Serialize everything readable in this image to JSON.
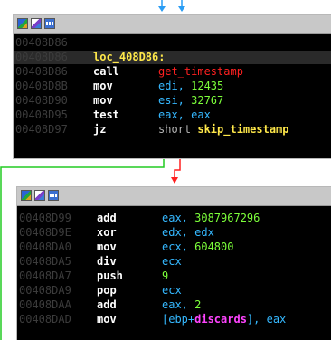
{
  "colors": {
    "node_bg": "#000000",
    "address": "#3c3c3c",
    "mnemonic": "#ffffff",
    "label": "#ffe84a",
    "call_target": "#ff2020",
    "register": "#35b8ff",
    "immediate": "#7cff3a",
    "var": "#ff44ff",
    "edge_true": "#22cc22",
    "edge_false": "#ff2020",
    "edge_blue": "#2a9df4"
  },
  "toolbar_icons": [
    "graph-colored-icon",
    "edit-color-icon",
    "assembly-view-icon"
  ],
  "block1": {
    "lines": [
      {
        "addr": "00408D86",
        "mn": "",
        "ops": []
      },
      {
        "addr": "00408D86",
        "label": "loc_408D86:"
      },
      {
        "addr": "00408D86",
        "mn": "call",
        "ops": [
          {
            "text": "get_timestamp",
            "cls": "op-red"
          }
        ]
      },
      {
        "addr": "00408D8B",
        "mn": "mov",
        "ops": [
          {
            "text": "edi, ",
            "cls": "op-cyan"
          },
          {
            "text": "12435",
            "cls": "op-lime"
          }
        ]
      },
      {
        "addr": "00408D90",
        "mn": "mov",
        "ops": [
          {
            "text": "esi, ",
            "cls": "op-cyan"
          },
          {
            "text": "32767",
            "cls": "op-lime"
          }
        ]
      },
      {
        "addr": "00408D95",
        "mn": "test",
        "ops": [
          {
            "text": "eax, eax",
            "cls": "op-cyan"
          }
        ]
      },
      {
        "addr": "00408D97",
        "mn": "jz",
        "ops": [
          {
            "text": "short ",
            "cls": "op-gray"
          },
          {
            "text": "skip_timestamp",
            "cls": "op-yellow"
          }
        ]
      }
    ]
  },
  "block2": {
    "lines": [
      {
        "addr": "00408D99",
        "mn": "add",
        "ops": [
          {
            "text": "eax, ",
            "cls": "op-cyan"
          },
          {
            "text": "3087967296",
            "cls": "op-lime"
          }
        ]
      },
      {
        "addr": "00408D9E",
        "mn": "xor",
        "ops": [
          {
            "text": "edx, edx",
            "cls": "op-cyan"
          }
        ]
      },
      {
        "addr": "00408DA0",
        "mn": "mov",
        "ops": [
          {
            "text": "ecx, ",
            "cls": "op-cyan"
          },
          {
            "text": "604800",
            "cls": "op-lime"
          }
        ]
      },
      {
        "addr": "00408DA5",
        "mn": "div",
        "ops": [
          {
            "text": "ecx",
            "cls": "op-cyan"
          }
        ]
      },
      {
        "addr": "00408DA7",
        "mn": "push",
        "ops": [
          {
            "text": "9",
            "cls": "op-lime"
          }
        ]
      },
      {
        "addr": "00408DA9",
        "mn": "pop",
        "ops": [
          {
            "text": "ecx",
            "cls": "op-cyan"
          }
        ]
      },
      {
        "addr": "00408DAA",
        "mn": "add",
        "ops": [
          {
            "text": "eax, ",
            "cls": "op-cyan"
          },
          {
            "text": "2",
            "cls": "op-lime"
          }
        ]
      },
      {
        "addr": "00408DAD",
        "mn": "mov",
        "ops": [
          {
            "text": "[ebp+",
            "cls": "op-cyan"
          },
          {
            "text": "discards",
            "cls": "op-magenta"
          },
          {
            "text": "], eax",
            "cls": "op-cyan"
          }
        ]
      }
    ]
  }
}
